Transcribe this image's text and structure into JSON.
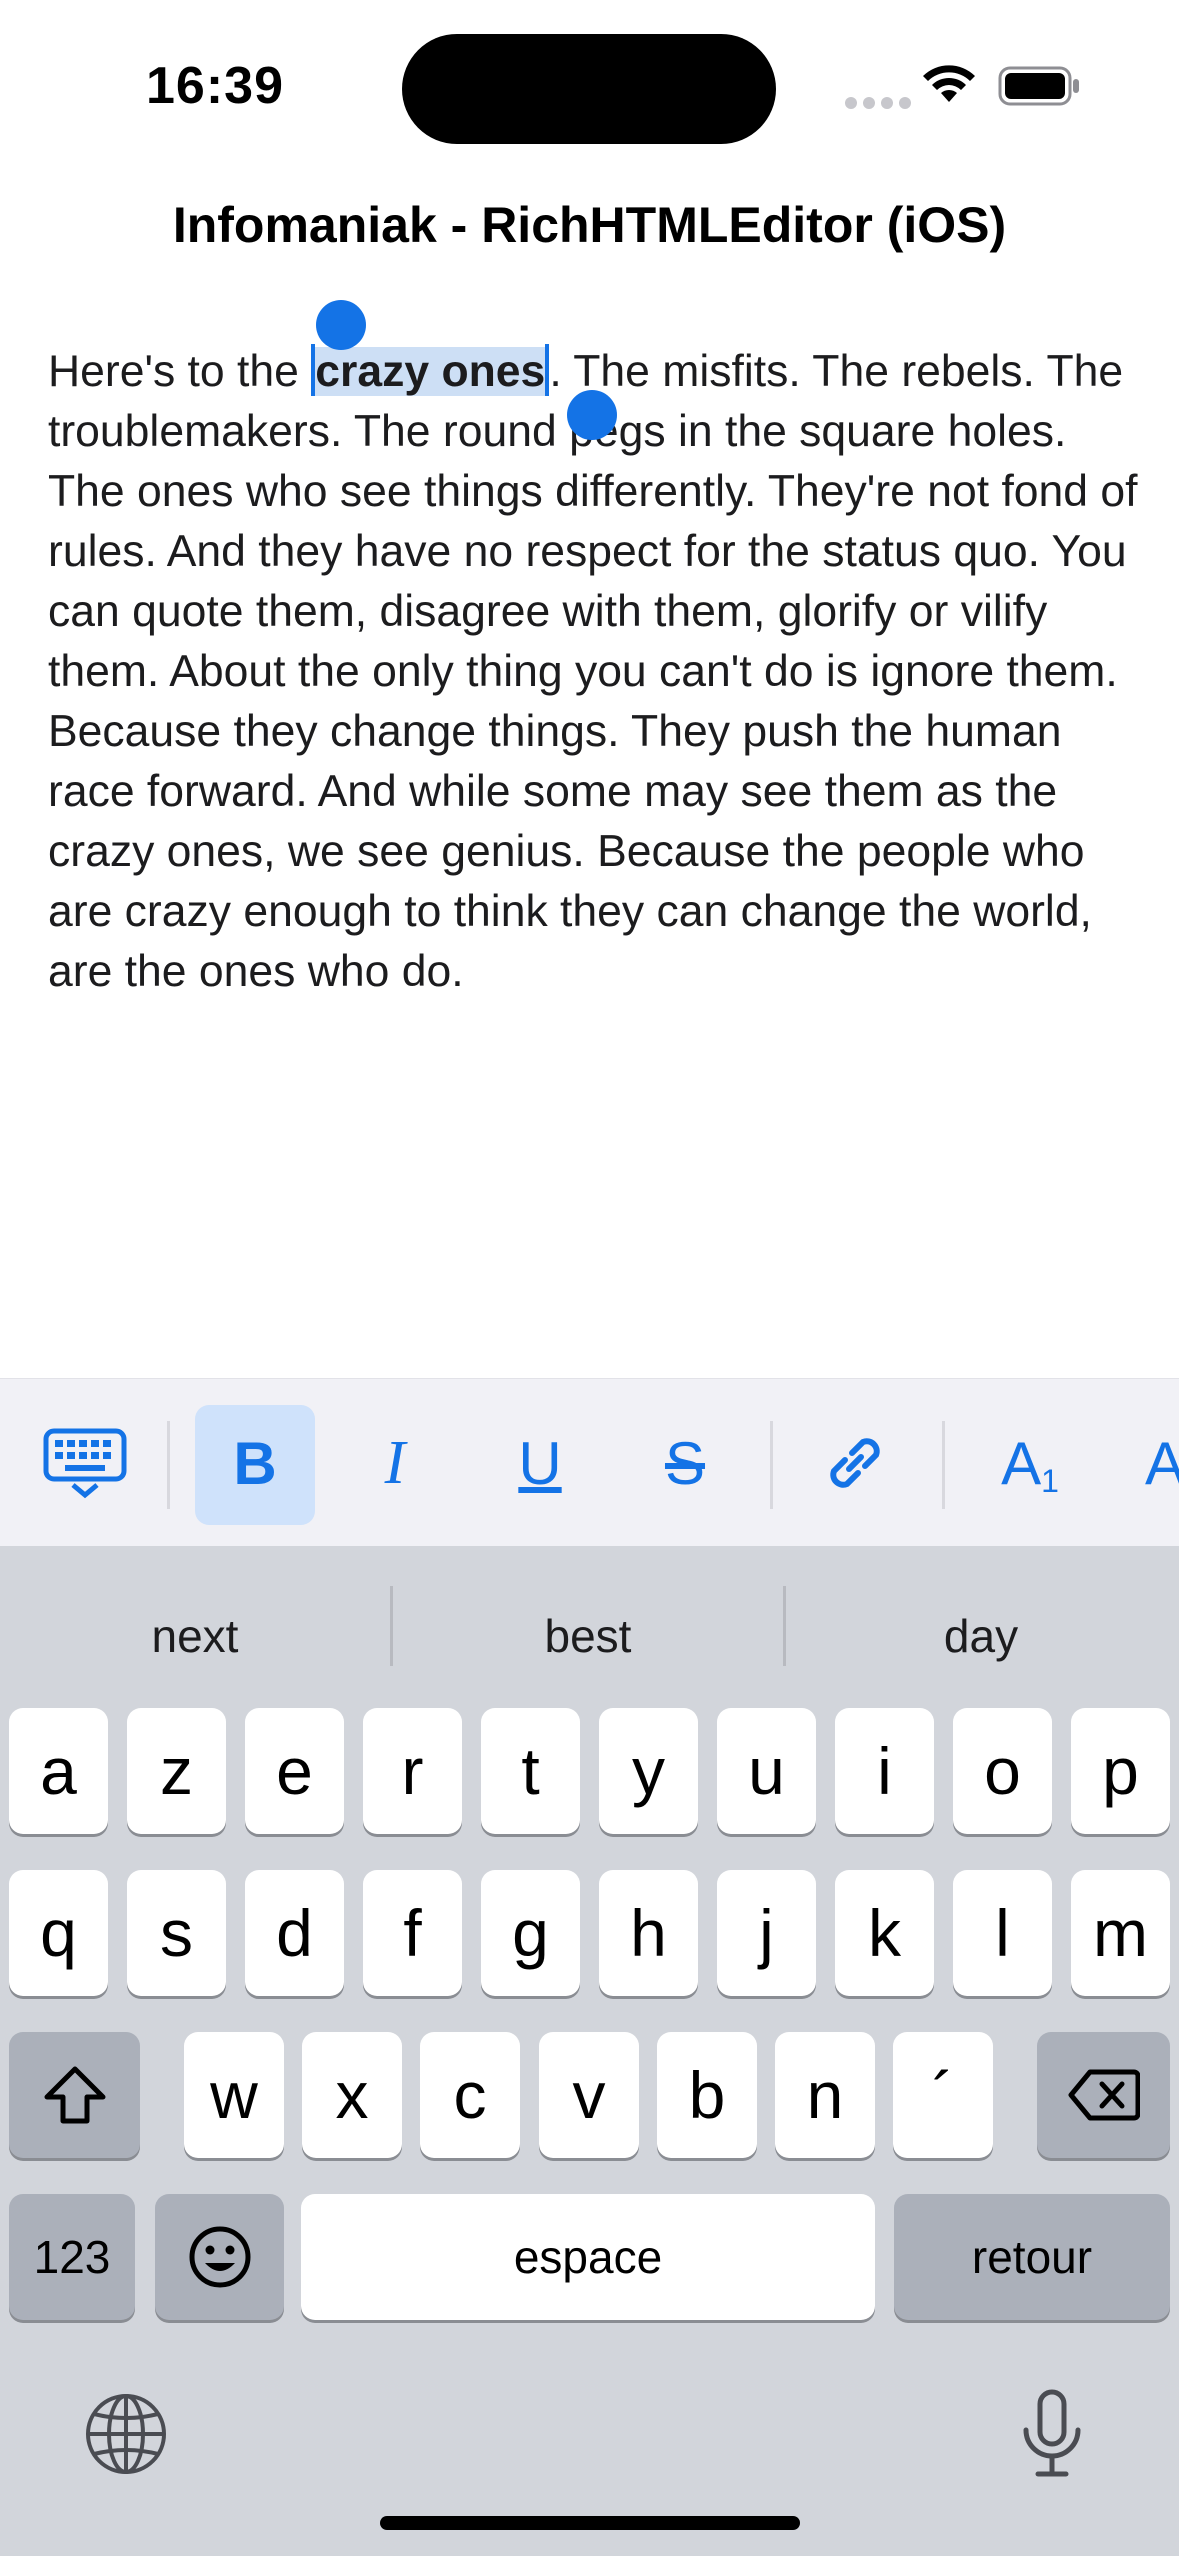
{
  "status_bar": {
    "time": "16:39"
  },
  "nav": {
    "title": "Infomaniak - RichHTMLEditor (iOS)"
  },
  "editor": {
    "before": "Here's to the ",
    "selected": "crazy ones",
    "after": ". The misfits. The rebels. The troublemakers. The round pegs in the square holes. The ones who see things differently. They're not fond of rules. And they have no respect for the status quo. You can quote them, disagree with them, glorify or vilify them. About the only thing you can't do is ignore them. Because they change things. They push the human race forward. And while some may see them as the crazy ones, we see genius. Because the people who are crazy enough to think they can change the world, are the ones who do."
  },
  "toolbar": {
    "bold": "B",
    "italic": "I",
    "underline": "U",
    "strike": "S",
    "subscript": "A",
    "subscript_index": "1",
    "superscript_partial": "A",
    "accent_color": "#1473e6",
    "active_bg": "#cfe2fb",
    "items": [
      "keyboard-dismiss-icon",
      "bold",
      "italic",
      "underline",
      "strikethrough",
      "link-icon",
      "subscript",
      "superscript"
    ]
  },
  "keyboard": {
    "suggestions": [
      "next",
      "best",
      "day"
    ],
    "row1": [
      "a",
      "z",
      "e",
      "r",
      "t",
      "y",
      "u",
      "i",
      "o",
      "p"
    ],
    "row2": [
      "q",
      "s",
      "d",
      "f",
      "g",
      "h",
      "j",
      "k",
      "l",
      "m"
    ],
    "row3": [
      "w",
      "x",
      "c",
      "v",
      "b",
      "n",
      "´"
    ],
    "numbers_key": "123",
    "space_key": "espace",
    "return_key": "retour"
  }
}
